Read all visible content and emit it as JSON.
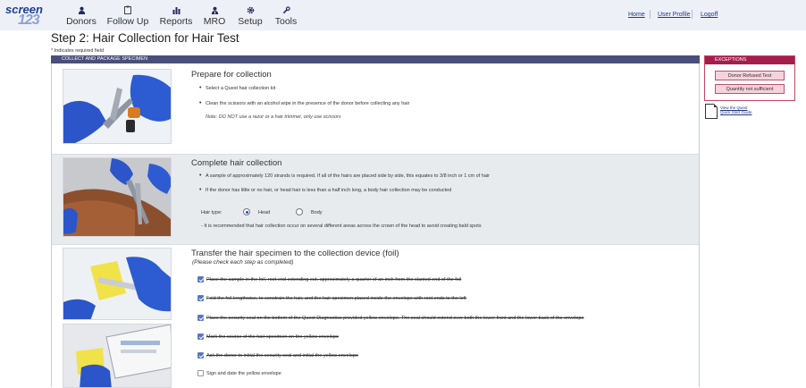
{
  "app": {
    "logo_text_top": "screen",
    "logo_text_bottom": "123"
  },
  "nav": [
    {
      "label": "Donors",
      "icon": "person-icon"
    },
    {
      "label": "Follow Up",
      "icon": "clipboard-icon"
    },
    {
      "label": "Reports",
      "icon": "bar-chart-icon"
    },
    {
      "label": "MRO",
      "icon": "doctor-icon"
    },
    {
      "label": "Setup",
      "icon": "gear-icon"
    },
    {
      "label": "Tools",
      "icon": "wrench-icon"
    }
  ],
  "top_links": {
    "home": "Home",
    "profile": "User Profile",
    "logoff": "Logoff"
  },
  "page": {
    "title": "Step 2: Hair Collection for Hair Test",
    "required_note": "* Indicates required field",
    "panel_header": "COLLECT AND PACKAGE SPECIMEN"
  },
  "sections": {
    "prepare": {
      "title": "Prepare for collection",
      "bullets": [
        "Select a Quest hair collection kit",
        "Clean the scissors with an alcohol wipe in the presence of the donor before collecting any hair"
      ],
      "note": "Note: DO NOT use a razor or a hair trimmer, only use scissors"
    },
    "complete": {
      "title": "Complete hair collection",
      "bullets": [
        "A sample of approximately 120 strands is required. If all of the hairs are placed side by side, this equates to 3/8 inch or 1 cm of hair",
        "If the donor has little or no hair, or head hair is less than a half inch long, a body hair collection may be conducted"
      ],
      "hair_type_label": "Hair type:",
      "hair_type_options": [
        "Head",
        "Body"
      ],
      "hair_type_selected": "Head",
      "recommendation": "- It is recommended that hair collection occur on several different areas across the crown of the head to avoid creating bald spots"
    },
    "transfer": {
      "title": "Transfer the hair specimen to the collection device (foil)",
      "subtitle": "(Please check each step as completed)",
      "steps": [
        {
          "text": "Place the sample in the foil, root end extending out, approximately a quarter of an inch from the slanted end of the foil",
          "checked": true
        },
        {
          "text": "Fold the foil lengthwise, to constrain the hair, and the hair specimen placed inside the envelope with root ends to the left",
          "checked": true
        },
        {
          "text": "Place the security seal on the bottom of the Quest Diagnostics provided yellow envelope. The seal should extend over both the lower front and the lower back of the envelope",
          "checked": true
        },
        {
          "text": "Mark the source of the hair specimen on the yellow envelope",
          "checked": true
        },
        {
          "text": "Ask the donor to initial the security seal and initial the yellow envelope",
          "checked": true
        },
        {
          "text": "Sign and date the yellow envelope",
          "checked": false
        }
      ]
    }
  },
  "exceptions": {
    "header": "EXCEPTIONS",
    "buttons": [
      "Donor Refused Test",
      "Quantity not sufficient"
    ]
  },
  "guide": {
    "link_line1": "View the Quest",
    "link_line2": "Quick Start Guide"
  },
  "colors": {
    "nav_bg": "#eef0f8",
    "panel_header": "#4a4f7a",
    "exception_header": "#a51d4d",
    "checkbox": "#4f73c9"
  }
}
